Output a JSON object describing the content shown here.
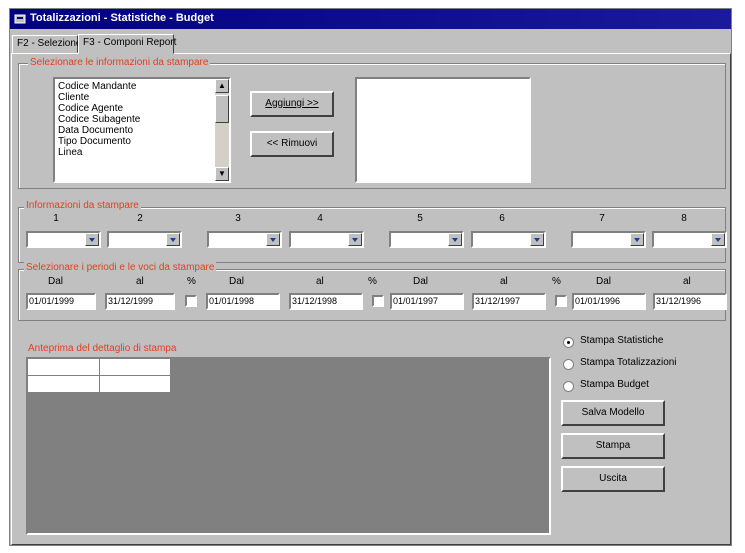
{
  "window": {
    "title": "Totalizzazioni - Statistiche - Budget"
  },
  "tabs": [
    {
      "label": "F2 - Selezione"
    },
    {
      "label": "F3 - Componi Report"
    }
  ],
  "selection": {
    "legend": "Selezionare le informazioni da stampare",
    "items": [
      "Codice Mandante",
      "Cliente",
      "Codice Agente",
      "Codice Subagente",
      "Data Documento",
      "Tipo Documento",
      "Linea"
    ],
    "add_button": "Aggiungi >>",
    "remove_button": "<< Rimuovi"
  },
  "print_info": {
    "legend": "Informazioni da stampare",
    "columns": [
      "1",
      "2",
      "3",
      "4",
      "5",
      "6",
      "7",
      "8"
    ]
  },
  "periods": {
    "legend": "Selezionare i periodi e le voci da stampare",
    "from_label": "Dal",
    "to_label": "al",
    "percent_label": "%",
    "ranges": [
      {
        "from": "01/01/1999",
        "to": "31/12/1999"
      },
      {
        "from": "01/01/1998",
        "to": "31/12/1998"
      },
      {
        "from": "01/01/1997",
        "to": "31/12/1997"
      },
      {
        "from": "01/01/1996",
        "to": "31/12/1996"
      }
    ]
  },
  "preview": {
    "label": "Anteprima del dettaglio di stampa"
  },
  "print_options": {
    "stampa_statistiche": "Stampa Statistiche",
    "stampa_totalizzazioni": "Stampa Totalizzazioni",
    "stampa_budget": "Stampa Budget",
    "selected": "Stampa Statistiche"
  },
  "actions": {
    "salva_modello": "Salva Modello",
    "stampa": "Stampa",
    "uscita": "Uscita"
  }
}
